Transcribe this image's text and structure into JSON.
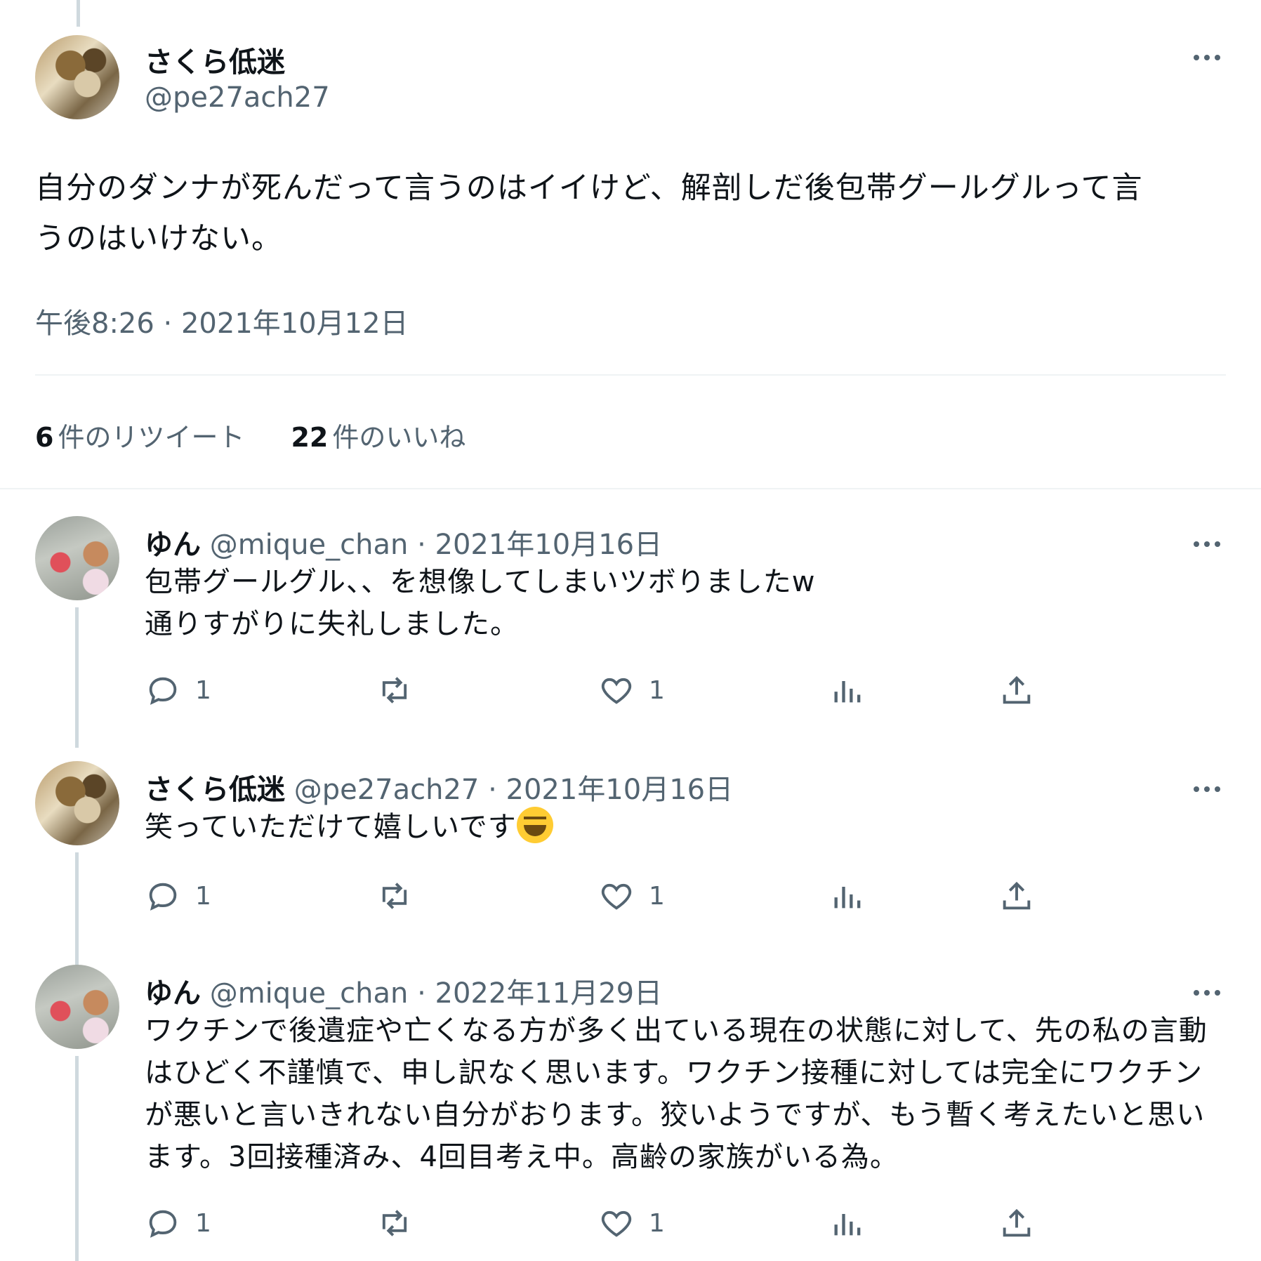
{
  "main_tweet": {
    "name": "さくら低迷",
    "handle": "@pe27ach27",
    "text_line1": "自分のダンナが死んだって言うのはイイけど、解剖しだ後包帯グールグルって言",
    "text_line2": "うのはいけない。",
    "timestamp": "午後8:26 · 2021年10月12日",
    "retweets_count": "6",
    "retweets_label": "件のリツイート",
    "likes_count": "22",
    "likes_label": "件のいいね"
  },
  "replies": [
    {
      "name": "ゆん",
      "meta": "@mique_chan · 2021年10月16日",
      "lines": [
        "包帯グールグル、、を想像してしまいツボりましたw",
        "通りすがりに失礼しました。"
      ],
      "reply_count": "1",
      "like_count": "1"
    },
    {
      "name": "さくら低迷",
      "meta": "@pe27ach27 · 2021年10月16日",
      "lines": [
        "笑っていただけて嬉しいです"
      ],
      "emoji": "grinning-squinting-face",
      "reply_count": "1",
      "like_count": "1"
    },
    {
      "name": "ゆん",
      "meta": "@mique_chan · 2022年11月29日",
      "lines": [
        "ワクチンで後遺症や亡くなる方が多く出ている現在の状態に対して、先の私の言動",
        "はひどく不謹慎で、申し訳なく思います。ワクチン接種に対しては完全にワクチン",
        "が悪いと言いきれない自分がおります。狡いようですが、もう暫く考えたいと思い",
        "ます。3回接種済み、4回目考え中。高齢の家族がいる為。"
      ],
      "reply_count": "1",
      "like_count": "1"
    }
  ],
  "icons": [
    "more-icon",
    "reply-icon",
    "retweet-icon",
    "like-icon",
    "views-icon",
    "share-icon"
  ],
  "colors": {
    "text": "#0f1419",
    "secondary": "#536471",
    "divider": "#eff3f4",
    "thread_line": "#cfd9de"
  }
}
